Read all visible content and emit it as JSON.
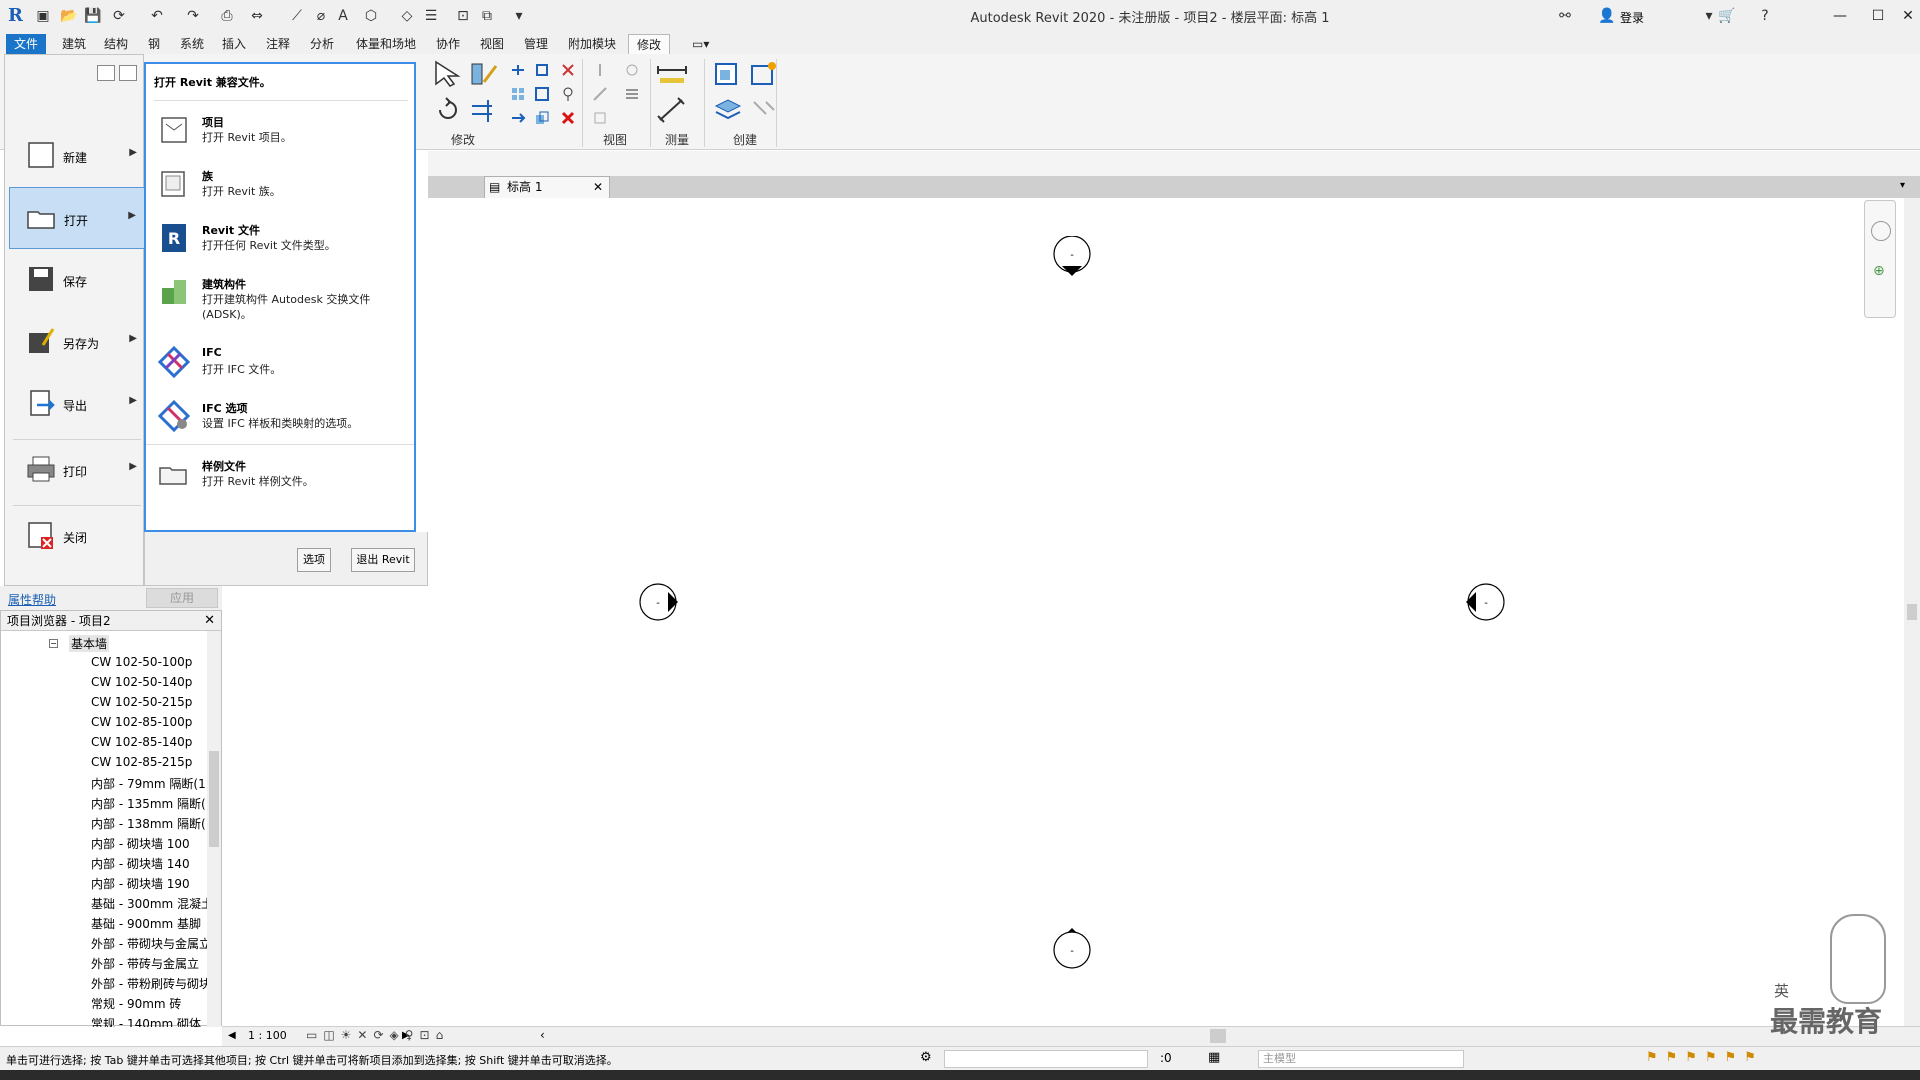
{
  "titlebar": {
    "window_title": "Autodesk Revit 2020 - 未注册版 - 项目2 - 楼层平面: 标高 1",
    "sign_in": "登录"
  },
  "ribbon_tabs": [
    "文件",
    "建筑",
    "结构",
    "钢",
    "系统",
    "插入",
    "注释",
    "分析",
    "体量和场地",
    "协作",
    "视图",
    "管理",
    "附加模块",
    "修改"
  ],
  "ribbon_panels": {
    "modify": "修改",
    "view": "视图",
    "measure": "测量",
    "create": "创建"
  },
  "app_menu": {
    "items": [
      {
        "label": "新建",
        "has_arrow": true
      },
      {
        "label": "打开",
        "has_arrow": true
      },
      {
        "label": "保存",
        "has_arrow": false
      },
      {
        "label": "另存为",
        "has_arrow": true
      },
      {
        "label": "导出",
        "has_arrow": true
      },
      {
        "label": "打印",
        "has_arrow": true
      },
      {
        "label": "关闭",
        "has_arrow": false
      }
    ],
    "submenu_title": "打开 Revit 兼容文件。",
    "submenu": [
      {
        "title": "项目",
        "desc": "打开 Revit 项目。"
      },
      {
        "title": "族",
        "desc": "打开 Revit 族。"
      },
      {
        "title": "Revit 文件",
        "desc": "打开任何 Revit 文件类型。"
      },
      {
        "title": "建筑构件",
        "desc": "打开建筑构件 Autodesk 交换文件 (ADSK)。"
      },
      {
        "title": "IFC",
        "desc": "打开 IFC 文件。"
      },
      {
        "title": "IFC 选项",
        "desc": "设置 IFC 样板和类映射的选项。"
      },
      {
        "title": "样例文件",
        "desc": "打开 Revit 样例文件。"
      }
    ],
    "options_button": "选项",
    "exit_button": "退出 Revit"
  },
  "properties": {
    "help_link": "属性帮助",
    "apply_button": "应用"
  },
  "browser": {
    "title": "项目浏览器 - 项目2",
    "group": "基本墙",
    "items": [
      "CW 102-50-100p",
      "CW 102-50-140p",
      "CW 102-50-215p",
      "CW 102-85-100p",
      "CW 102-85-140p",
      "CW 102-85-215p",
      "内部 - 79mm 隔断(1",
      "内部 - 135mm 隔断(",
      "内部 - 138mm 隔断(",
      "内部 - 砌块墙 100",
      "内部 - 砌块墙 140",
      "内部 - 砌块墙 190",
      "基础 - 300mm 混凝土",
      "基础 - 900mm 基脚",
      "外部 - 带砌块与金属立",
      "外部 - 带砖与金属立",
      "外部 - 带粉刷砖与砌块",
      "常规 - 90mm 砖",
      "常规 - 140mm 砌体"
    ]
  },
  "view_tab": {
    "label": "标高 1"
  },
  "viewbar": {
    "scale": "1 : 100"
  },
  "statusbar": {
    "message": "单击可进行选择; 按 Tab 键并单击可选择其他项目; 按 Ctrl 键并单击可将新项目添加到选择集; 按 Shift 键并单击可取消选择。",
    "count": ":0",
    "model": "主模型"
  },
  "watermark": {
    "text": "最需教育",
    "ime": "英"
  },
  "markers": {
    "symbol": "-"
  }
}
